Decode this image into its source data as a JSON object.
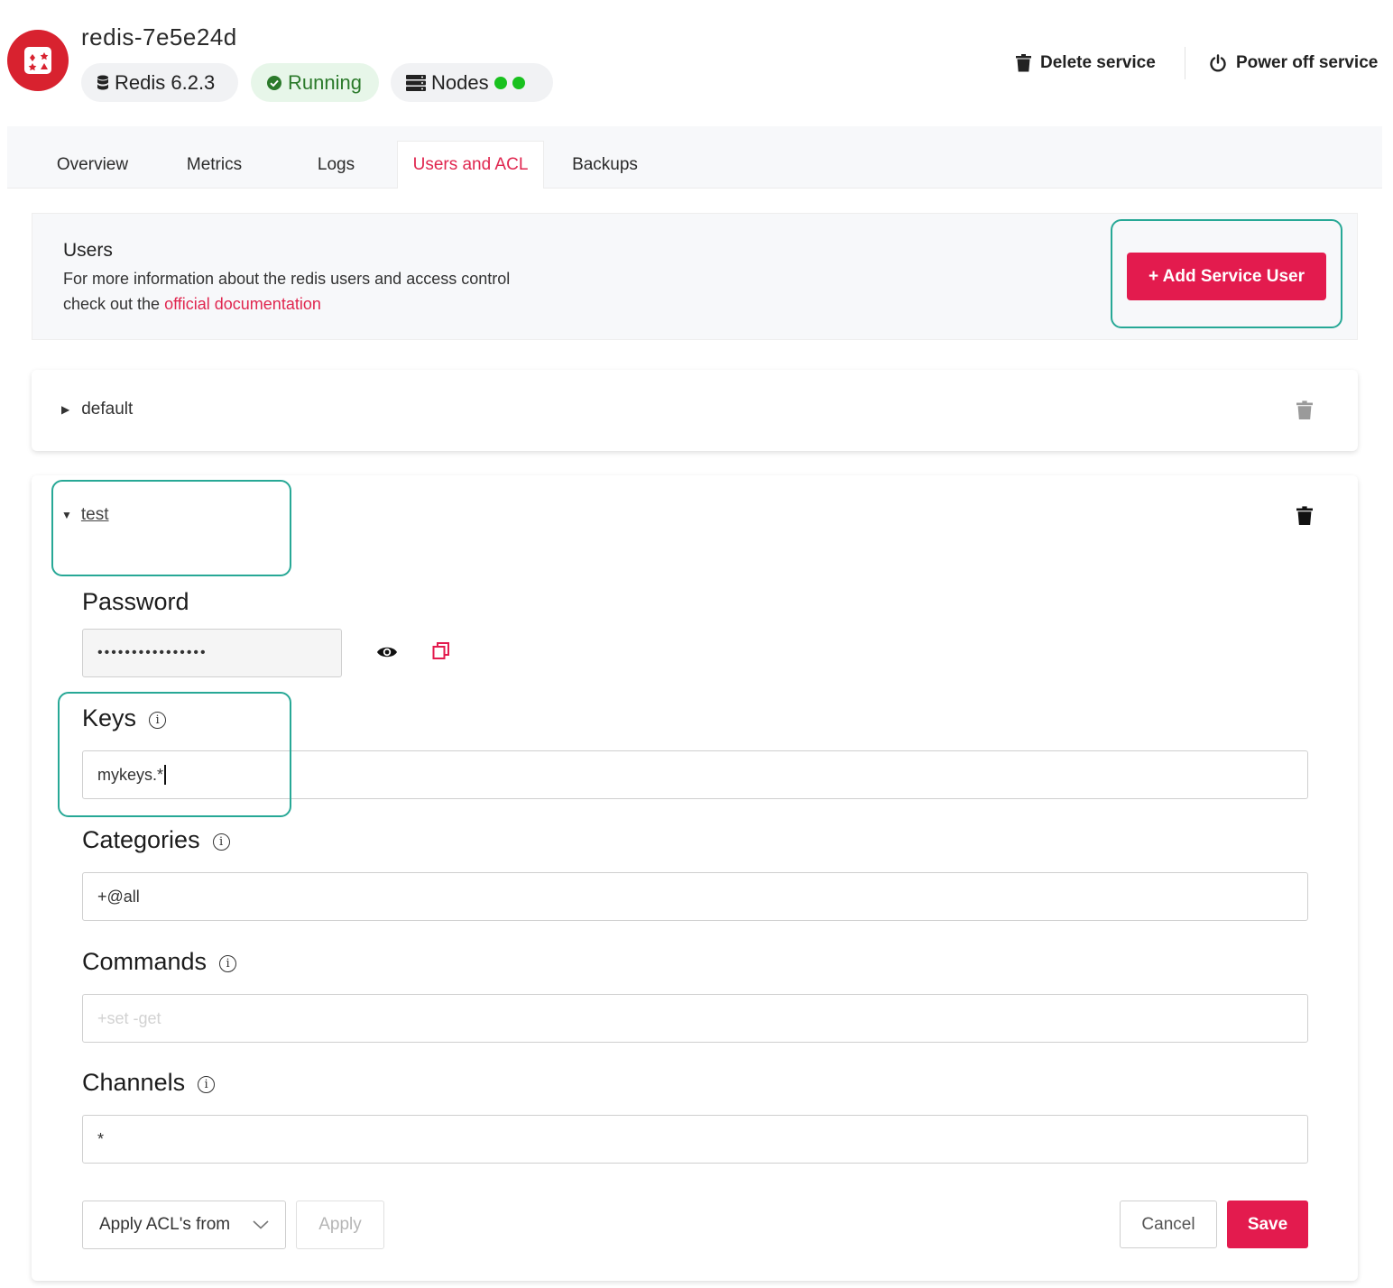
{
  "service": {
    "name": "redis-7e5e24d",
    "version_label": "Redis 6.2.3",
    "status_label": "Running",
    "nodes_label": "Nodes",
    "node_dots": 2
  },
  "header_actions": {
    "delete_label": "Delete service",
    "power_off_label": "Power off service"
  },
  "tabs": [
    {
      "label": "Overview",
      "active": false
    },
    {
      "label": "Metrics",
      "active": false
    },
    {
      "label": "Logs",
      "active": false
    },
    {
      "label": "Users and ACL",
      "active": true
    },
    {
      "label": "Backups",
      "active": false
    }
  ],
  "users_section": {
    "title": "Users",
    "desc_line1": "For more information about the redis users and access control",
    "desc_line2_prefix": "check out the ",
    "doc_link": "official documentation",
    "add_button": "+ Add Service User"
  },
  "users": [
    {
      "name": "default",
      "expanded": false
    },
    {
      "name": "test",
      "expanded": true
    }
  ],
  "form": {
    "password_label": "Password",
    "password_value": "••••••••••••••••",
    "keys_label": "Keys",
    "keys_value": "mykeys.*",
    "categories_label": "Categories",
    "categories_value": "+@all",
    "commands_label": "Commands",
    "commands_placeholder": "+set -get",
    "channels_label": "Channels",
    "channels_value": "*",
    "apply_acl_select": "Apply ACL's from",
    "apply_button": "Apply",
    "cancel_button": "Cancel",
    "save_button": "Save"
  },
  "colors": {
    "brand_red": "#e31b4e",
    "tab_active": "#e0264f",
    "status_green": "#19c11e",
    "highlight": "#27a896"
  }
}
